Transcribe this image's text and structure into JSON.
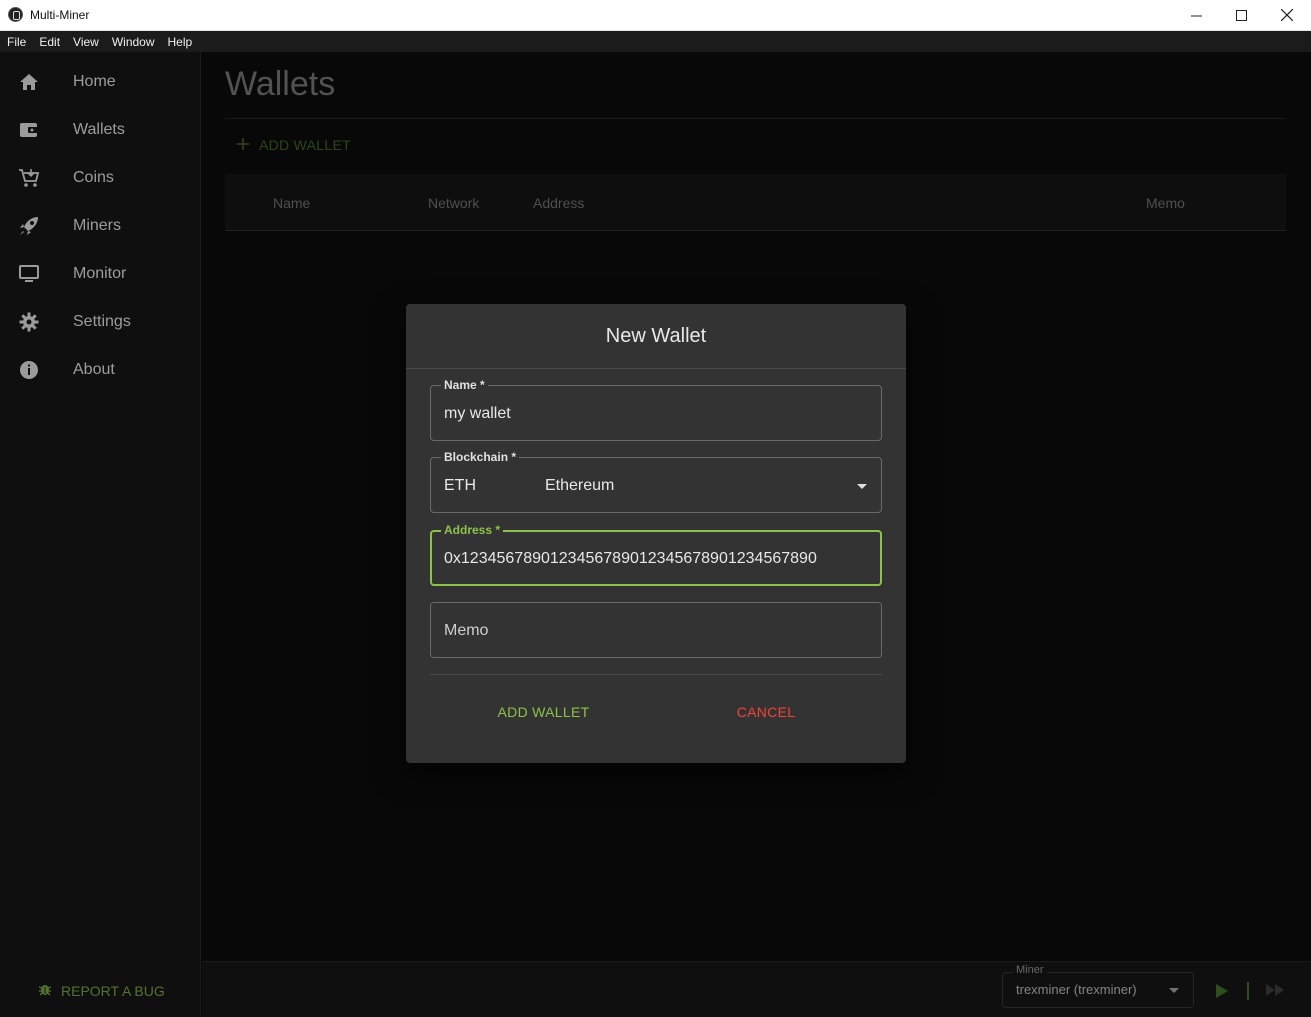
{
  "window": {
    "title": "Multi-Miner"
  },
  "menu": [
    "File",
    "Edit",
    "View",
    "Window",
    "Help"
  ],
  "sidebar": {
    "items": [
      {
        "label": "Home",
        "icon": "home-icon"
      },
      {
        "label": "Wallets",
        "icon": "wallet-icon"
      },
      {
        "label": "Coins",
        "icon": "cart-icon"
      },
      {
        "label": "Miners",
        "icon": "rocket-icon"
      },
      {
        "label": "Monitor",
        "icon": "monitor-icon"
      },
      {
        "label": "Settings",
        "icon": "gear-icon"
      },
      {
        "label": "About",
        "icon": "info-icon"
      }
    ],
    "report_bug": "REPORT A BUG"
  },
  "main": {
    "title": "Wallets",
    "add_wallet": "ADD WALLET",
    "columns": [
      "Name",
      "Network",
      "Address",
      "Memo"
    ]
  },
  "dialog": {
    "title": "New Wallet",
    "name": {
      "label": "Name *",
      "value": "my wallet"
    },
    "blockchain": {
      "label": "Blockchain *",
      "code": "ETH",
      "name": "Ethereum"
    },
    "address": {
      "label": "Address *",
      "value": "0x1234567890123456789012345678901234567890"
    },
    "memo": {
      "placeholder": "Memo"
    },
    "add_button": "ADD WALLET",
    "cancel_button": "CANCEL"
  },
  "bottom": {
    "miner_label": "Miner",
    "miner_value": "trexminer (trexminer)"
  },
  "colors": {
    "accent": "#8bc34a",
    "danger": "#f44336",
    "dialog_bg": "#333333",
    "sidebar_bg": "#141414"
  }
}
